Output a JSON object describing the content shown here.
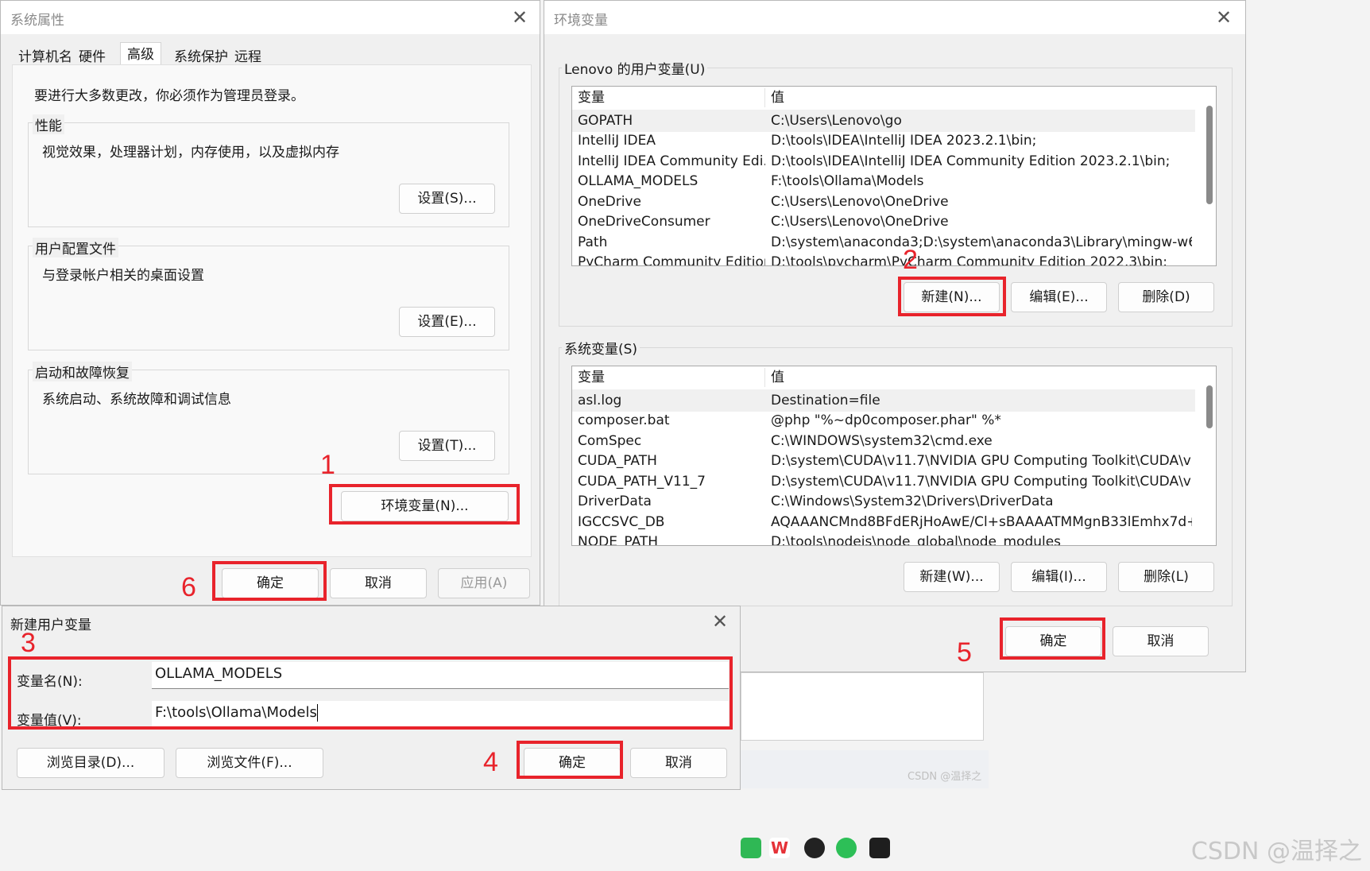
{
  "sysprops": {
    "title": "系统属性",
    "tabs": [
      "计算机名",
      "硬件",
      "高级",
      "系统保护",
      "远程"
    ],
    "admin_note": "要进行大多数更改，你必须作为管理员登录。",
    "groups": [
      {
        "label": "性能",
        "desc": "视觉效果，处理器计划，内存使用，以及虚拟内存",
        "button": "设置(S)..."
      },
      {
        "label": "用户配置文件",
        "desc": "与登录帐户相关的桌面设置",
        "button": "设置(E)..."
      },
      {
        "label": "启动和故障恢复",
        "desc": "系统启动、系统故障和调试信息",
        "button": "设置(T)..."
      }
    ],
    "env_button": "环境变量(N)...",
    "ok": "确定",
    "cancel": "取消",
    "apply": "应用(A)"
  },
  "envvars": {
    "title": "环境变量",
    "user_label": "Lenovo 的用户变量(U)",
    "sys_label": "系统变量(S)",
    "col_var": "变量",
    "col_val": "值",
    "user_rows": [
      {
        "name": "GOPATH",
        "value": "C:\\Users\\Lenovo\\go"
      },
      {
        "name": "IntelliJ IDEA",
        "value": "D:\\tools\\IDEA\\IntelliJ IDEA 2023.2.1\\bin;"
      },
      {
        "name": "IntelliJ IDEA Community Edi...",
        "value": "D:\\tools\\IDEA\\IntelliJ IDEA Community Edition 2023.2.1\\bin;"
      },
      {
        "name": "OLLAMA_MODELS",
        "value": "F:\\tools\\Ollama\\Models"
      },
      {
        "name": "OneDrive",
        "value": "C:\\Users\\Lenovo\\OneDrive"
      },
      {
        "name": "OneDriveConsumer",
        "value": "C:\\Users\\Lenovo\\OneDrive"
      },
      {
        "name": "Path",
        "value": "D:\\system\\anaconda3;D:\\system\\anaconda3\\Library\\mingw-w64\\..."
      },
      {
        "name": "PyCharm Community Edition",
        "value": "D:\\tools\\pycharm\\PyCharm Community Edition 2022.3\\bin;"
      }
    ],
    "sys_rows": [
      {
        "name": "asl.log",
        "value": "Destination=file"
      },
      {
        "name": "composer.bat",
        "value": "@php \"%~dp0composer.phar\" %*"
      },
      {
        "name": "ComSpec",
        "value": "C:\\WINDOWS\\system32\\cmd.exe"
      },
      {
        "name": "CUDA_PATH",
        "value": "D:\\system\\CUDA\\v11.7\\NVIDIA GPU Computing Toolkit\\CUDA\\v1..."
      },
      {
        "name": "CUDA_PATH_V11_7",
        "value": "D:\\system\\CUDA\\v11.7\\NVIDIA GPU Computing Toolkit\\CUDA\\v1..."
      },
      {
        "name": "DriverData",
        "value": "C:\\Windows\\System32\\Drivers\\DriverData"
      },
      {
        "name": "IGCCSVC_DB",
        "value": "AQAAANCMnd8BFdERjHoAwE/Cl+sBAAAATMMgnB33lEmhx7d+..."
      },
      {
        "name": "NODE_PATH",
        "value": "D:\\tools\\nodejs\\node_global\\node_modules"
      }
    ],
    "user_new": "新建(N)...",
    "user_edit": "编辑(E)...",
    "user_delete": "删除(D)",
    "sys_new": "新建(W)...",
    "sys_edit": "编辑(I)...",
    "sys_delete": "删除(L)",
    "ok": "确定",
    "cancel": "取消"
  },
  "newvar": {
    "title": "新建用户变量",
    "name_label": "变量名(N):",
    "name_value": "OLLAMA_MODELS",
    "value_label": "变量值(V):",
    "value_value": "F:\\tools\\Ollama\\Models",
    "browse_dir": "浏览目录(D)...",
    "browse_file": "浏览文件(F)...",
    "ok": "确定",
    "cancel": "取消"
  },
  "annotations": {
    "n1": "1",
    "n2": "2",
    "n3": "3",
    "n4": "4",
    "n5": "5",
    "n6": "6"
  },
  "watermark": "CSDN @温择之",
  "taskbar_hint": "CSDN @温择之",
  "colors": {
    "highlight": "#e8232b",
    "window_bg": "#f0f0f0"
  }
}
